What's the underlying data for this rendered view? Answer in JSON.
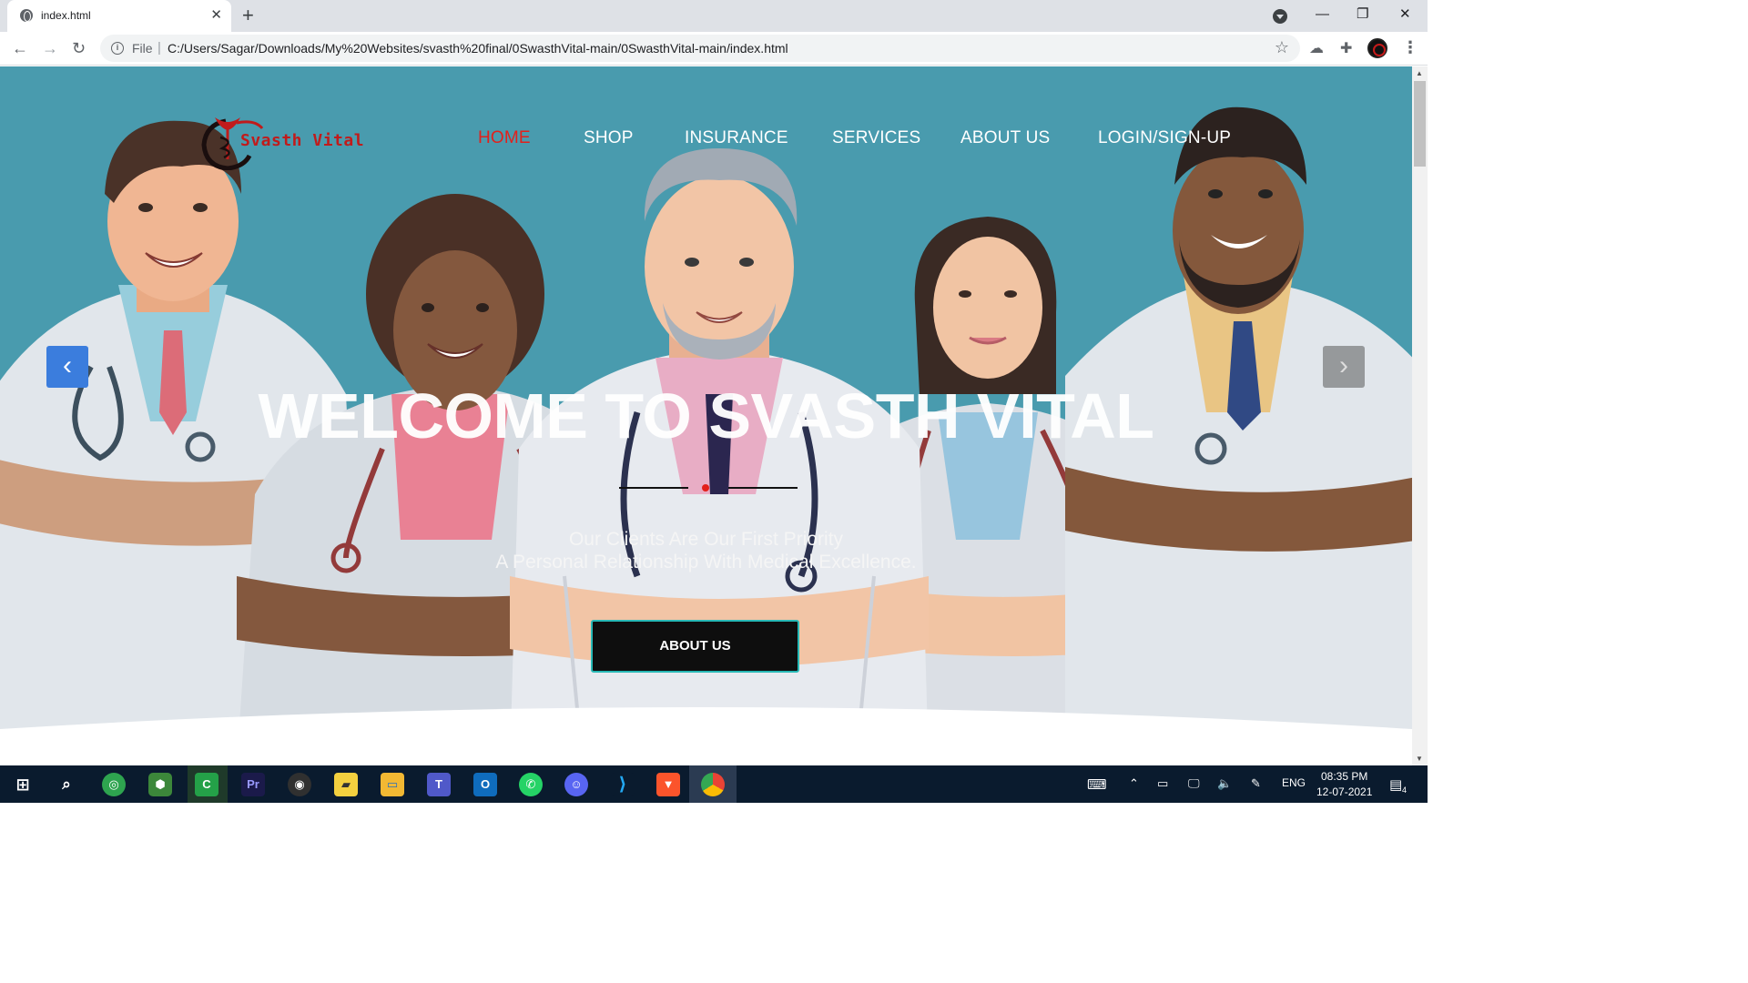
{
  "browser": {
    "tab_title": "index.html",
    "tab_close": "✕",
    "new_tab": "+",
    "window_controls": {
      "minimize": "—",
      "restore": "❐",
      "close": "✕"
    },
    "nav": {
      "back": "←",
      "forward": "→",
      "reload": "↻"
    },
    "scheme_label": "File",
    "url": "C:/Users/Sagar/Downloads/My%20Websites/svasth%20final/0SwasthVital-main/0SwasthVital-main/index.html",
    "bookmark_icon": "star-icon",
    "menu": "⋮"
  },
  "site": {
    "logo_text": "Svasth Vital",
    "nav_items": [
      "HOME",
      "SHOP",
      "INSURANCE",
      "SERVICES",
      "ABOUT US",
      "LOGIN/SIGN-UP"
    ],
    "active_nav": "HOME",
    "headline": "WELCOME TO SVASTH VITAL",
    "subtitle_1": "Our Clients Are Our First Priority",
    "subtitle_2": "A Personal Relationship With Medical Excellence.",
    "cta_label": "ABOUT US",
    "carousel_prev": "‹",
    "carousel_next": "›",
    "colors": {
      "hero_bg": "#3a93a8",
      "accent": "#e3201b",
      "cta_bg": "#0e0e0e",
      "cta_border": "#27b8b5"
    }
  },
  "taskbar": {
    "language": "ENG",
    "time": "08:35 PM",
    "date": "12-07-2021",
    "notification_count": "4",
    "apps": [
      "start-icon",
      "search-icon",
      "chrome-remote-icon",
      "node-icon",
      "camtasia-icon",
      "premiere-icon",
      "obs-icon",
      "sticky-notes-icon",
      "file-explorer-icon",
      "teams-icon",
      "outlook-icon",
      "whatsapp-icon",
      "discord-icon",
      "vscode-icon",
      "brave-icon",
      "chrome-icon"
    ]
  }
}
